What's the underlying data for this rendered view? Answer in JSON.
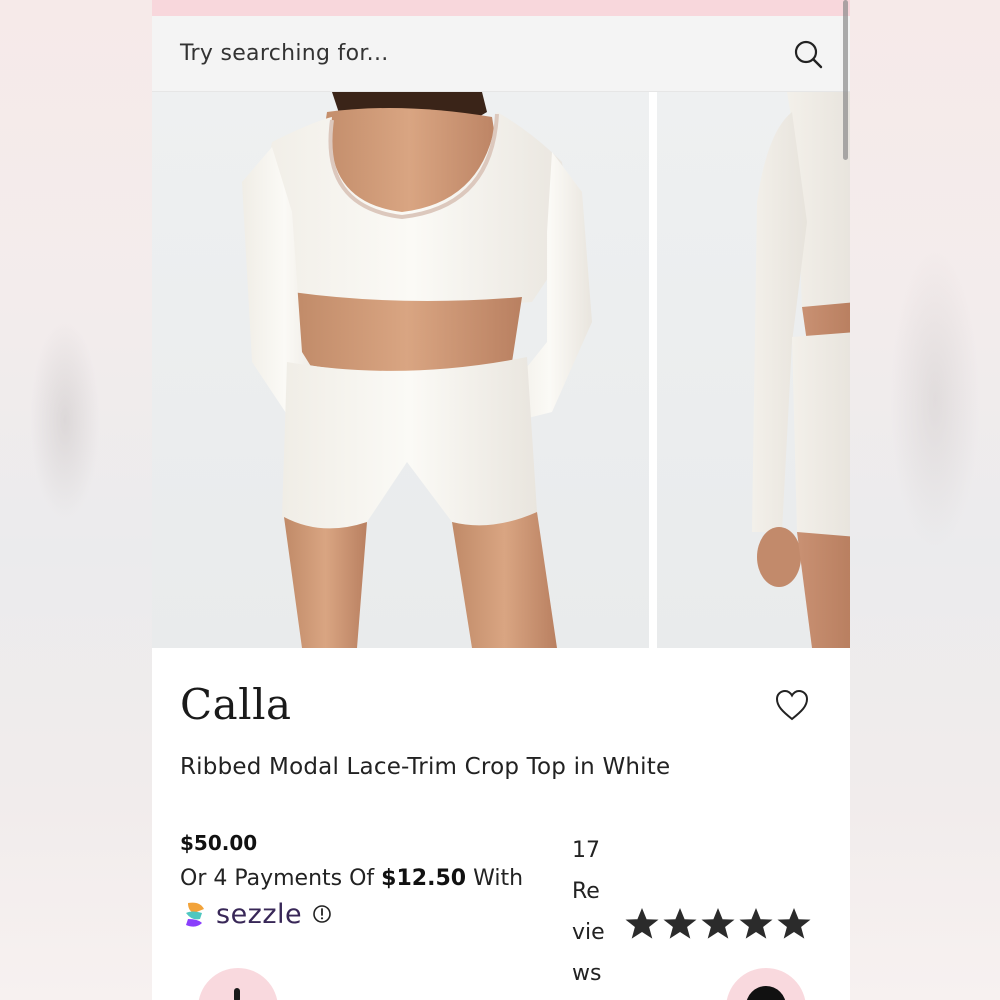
{
  "search": {
    "placeholder": "Try searching for..."
  },
  "gallery": {
    "images": [
      {
        "name": "Model wearing white ribbed crop top and shorts, front view"
      },
      {
        "name": "Model wearing white ribbed crop top and shorts, back view"
      }
    ]
  },
  "product": {
    "brand": "Calla",
    "title": "Ribbed Modal Lace-Trim Crop Top in White",
    "price": "$50.00",
    "installments_prefix": "Or 4 Payments Of ",
    "installment_amount": "$12.50",
    "installments_suffix": " With",
    "payment_provider": "sezzle",
    "reviews_text": "17 Reviews",
    "rating": 5,
    "rating_max": 5
  },
  "colors": {
    "promo_strip": "#f8d7dc",
    "sezzle_text": "#382757",
    "star": "#2b2b2b",
    "fab": "#f9d9de"
  },
  "icons": {
    "search": "search-icon",
    "wishlist": "heart-icon",
    "info": "info-icon",
    "sezzle": "sezzle-logo-icon",
    "star": "star-icon"
  }
}
